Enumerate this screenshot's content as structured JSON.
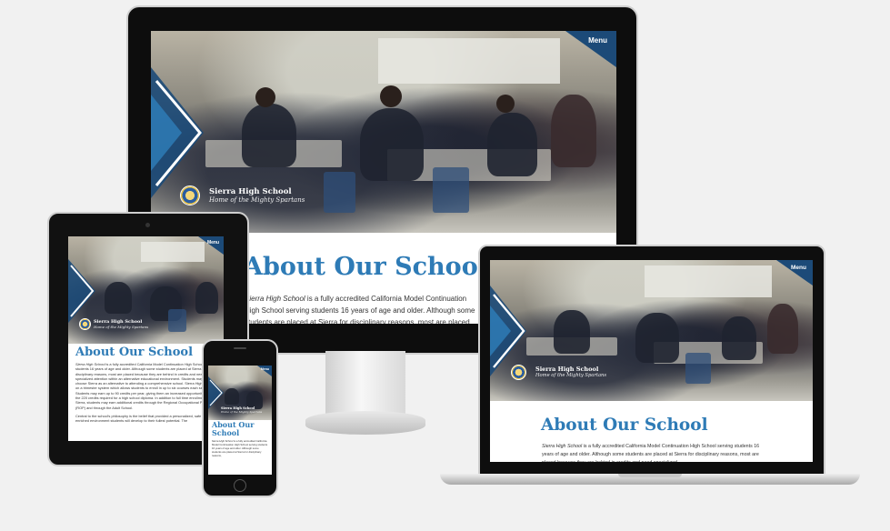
{
  "site": {
    "menu_label": "Menu",
    "school_name": "Sierra High School",
    "tagline": "Home of the Mighty Spartans",
    "heading": "About Our School",
    "heading_phone_line1": "About Our",
    "heading_phone_line2": "School",
    "intro_em": "Sierra High School",
    "intro_rest": " is a fully accredited California Model Continuation High School serving students 16 years of age and older. Although some students are placed at Sierra for disciplinary reasons, most are placed because they are behind in credits and need specialized",
    "tablet_para1_rest": " is a fully accredited California Model Continuation High School serving students 16 years of age and older. Although some students are placed at Sierra for disciplinary reasons, most are placed because they are behind in credits and need specialized attention within an alternative educational environment. Students may also choose Sierra as an alternative to attending a comprehensive school. Sierra High School is on a trimester system which allows students to enroll in up to six courses each session. Students may earn up to 90 credits per year, giving them an increased opportunity to earn the 220 credits required for a high school diploma. In addition to full time enrollment at Sierra, students may earn additional credits through the Regional Occupational Program (ROP) and through the Adult School.",
    "tablet_para2": "Central to the school's philosophy is the belief that provided a personalized, safe and enriched environment students will develop to their fullest potential. The",
    "phone_para_rest": " is a fully accredited California Model Continuation High School serving students 16 years of age and older. Although some students are placed at Sierra for disciplinary reasons,",
    "laptop_para_rest": " is a fully accredited California Model Continuation High School serving students 16 years of age and older. Although some students are placed at Sierra for disciplinary reasons, most are placed because they are behind in credits and need specialized"
  },
  "colors": {
    "accent": "#2e7bb6",
    "navy": "#1c4a78",
    "device_black": "#111111"
  }
}
